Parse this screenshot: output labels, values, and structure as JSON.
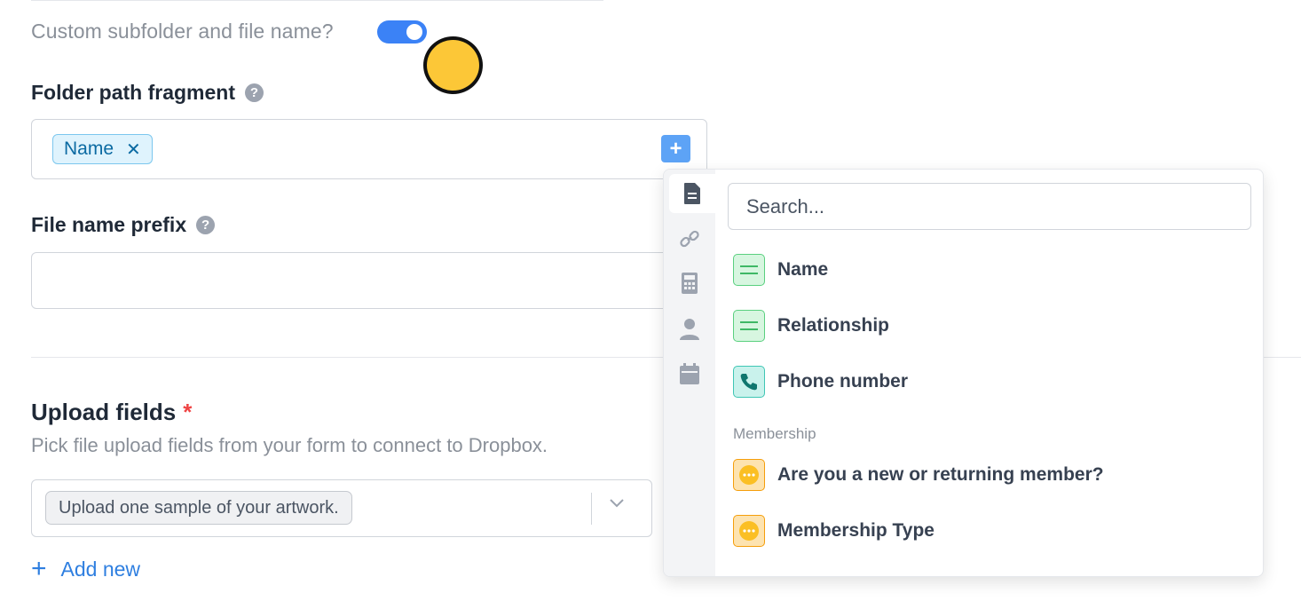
{
  "toggle_row": {
    "label": "Custom subfolder and file name?",
    "checked": true
  },
  "folder_path": {
    "label": "Folder path fragment",
    "help_icon": "?",
    "tags": [
      {
        "label": "Name",
        "remove_icon": "✕"
      }
    ],
    "add_icon": "+"
  },
  "file_prefix": {
    "label": "File name prefix",
    "help_icon": "?",
    "value": ""
  },
  "upload": {
    "title": "Upload fields",
    "required_mark": "*",
    "description": "Pick file upload fields from your form to connect to Dropbox.",
    "selected": "Upload one sample of your artwork.",
    "add_new_icon": "+",
    "add_new": "Add new"
  },
  "dropdown": {
    "search_placeholder": "Search...",
    "rail_icons": [
      "document-icon",
      "link-icon",
      "calculator-icon",
      "person-icon",
      "calendar-icon"
    ],
    "items": [
      {
        "label": "Name",
        "icon": "text-field-icon"
      },
      {
        "label": "Relationship",
        "icon": "text-field-icon"
      },
      {
        "label": "Phone number",
        "icon": "phone-icon"
      }
    ],
    "group": "Membership",
    "group_items": [
      {
        "label": "Are you a new or returning member?",
        "icon": "choice-icon"
      },
      {
        "label": "Membership Type",
        "icon": "choice-icon"
      }
    ]
  },
  "colors": {
    "accent": "#3b82f6",
    "tag_bg": "#dff3fd",
    "text_field": "#5ad07f",
    "phone_field": "#3fc6b4",
    "choice_field": "#f59e0b",
    "required": "#ef4444"
  }
}
